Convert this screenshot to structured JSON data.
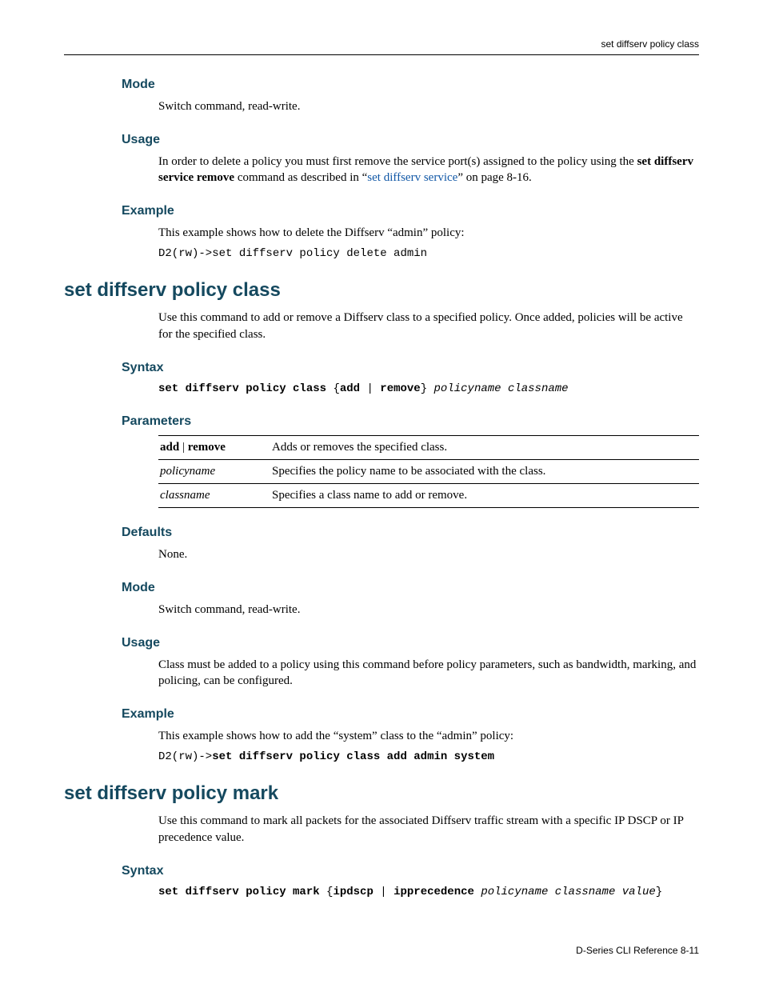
{
  "header": {
    "running": "set diffserv policy class"
  },
  "footer": {
    "text": "D-Series CLI Reference    8-11"
  },
  "s1": {
    "mode_h": "Mode",
    "mode_p": "Switch command, read-write.",
    "usage_h": "Usage",
    "usage_p1a": "In order to delete a policy you must first remove the service port(s) assigned to the policy using the ",
    "usage_bold": "set diffserv service remove",
    "usage_p1b": " command as described in “",
    "usage_link": "set diffserv service",
    "usage_p1c": "” on page 8-16.",
    "example_h": "Example",
    "example_p": "This example shows how to delete the Diffserv “admin” policy:",
    "example_code": "D2(rw)->set diffserv policy delete admin"
  },
  "s2": {
    "title": "set diffserv policy class",
    "intro": "Use this command to add or remove a Diffserv class to a specified policy. Once added, policies will be active for the specified class.",
    "syntax_h": "Syntax",
    "syntax_cmd": "set diffserv policy class",
    "syntax_opt1": "add",
    "syntax_pipe": " | ",
    "syntax_opt2": "remove",
    "syntax_args": "policyname classname",
    "params_h": "Parameters",
    "params": [
      {
        "name_bold1": "add",
        "name_sep": " | ",
        "name_bold2": "remove",
        "desc": "Adds or removes the specified class."
      },
      {
        "name_ital": "policyname",
        "desc": "Specifies the policy name to be associated with the class."
      },
      {
        "name_ital": "classname",
        "desc": "Specifies a class name to add or remove."
      }
    ],
    "defaults_h": "Defaults",
    "defaults_p": "None.",
    "mode_h": "Mode",
    "mode_p": "Switch command, read-write.",
    "usage_h": "Usage",
    "usage_p": "Class must be added to a policy using this command before policy parameters, such as bandwidth, marking, and policing, can be configured.",
    "example_h": "Example",
    "example_p": "This example shows how to add the “system” class to the “admin” policy:",
    "example_prompt": "D2(rw)->",
    "example_bold": "set diffserv policy class add admin system"
  },
  "s3": {
    "title": "set diffserv policy mark",
    "intro": "Use this command to mark all packets for the associated Diffserv traffic stream with a specific IP DSCP or IP precedence value.",
    "syntax_h": "Syntax",
    "syntax_cmd": "set diffserv policy mark",
    "syntax_opt1": "ipdscp",
    "syntax_pipe": " | ",
    "syntax_opt2": "ipprecedence",
    "syntax_args": "policyname classname value"
  }
}
